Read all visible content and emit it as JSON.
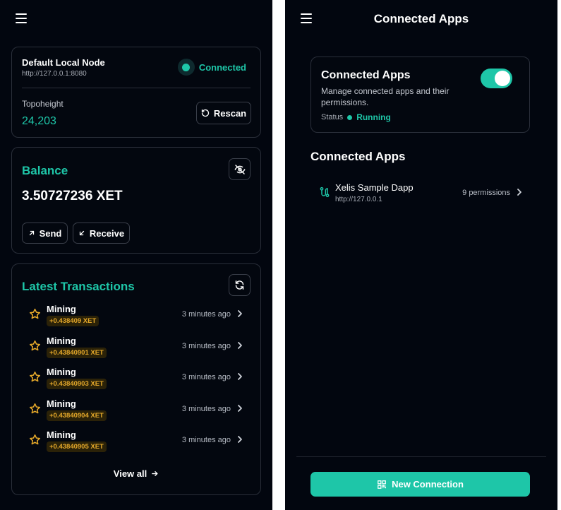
{
  "left": {
    "node": {
      "name": "Default Local Node",
      "url": "http://127.0.0.1:8080",
      "status": "Connected",
      "topoheight_label": "Topoheight",
      "topoheight_value": "24,203",
      "rescan_label": "Rescan"
    },
    "balance": {
      "title": "Balance",
      "amount": "3.50727236 XET",
      "send_label": "Send",
      "receive_label": "Receive"
    },
    "transactions": {
      "title": "Latest Transactions",
      "items": [
        {
          "type": "Mining",
          "amount": "+0.438409 XET",
          "time": "3 minutes ago"
        },
        {
          "type": "Mining",
          "amount": "+0.43840901 XET",
          "time": "3 minutes ago"
        },
        {
          "type": "Mining",
          "amount": "+0.43840903 XET",
          "time": "3 minutes ago"
        },
        {
          "type": "Mining",
          "amount": "+0.43840904 XET",
          "time": "3 minutes ago"
        },
        {
          "type": "Mining",
          "amount": "+0.43840905 XET",
          "time": "3 minutes ago"
        }
      ],
      "view_all_label": "View all"
    }
  },
  "right": {
    "title": "Connected Apps",
    "service": {
      "title": "Connected Apps",
      "description": "Manage connected apps and their permissions.",
      "status_label": "Status",
      "status_value": "Running",
      "enabled": true
    },
    "section_title": "Connected Apps",
    "apps": [
      {
        "name": "Xelis Sample Dapp",
        "url": "http://127.0.0.1",
        "permissions": "9 permissions"
      }
    ],
    "new_connection_label": "New Connection"
  },
  "colors": {
    "accent": "#1ec6a8",
    "background": "#02060f",
    "amount": "#e6a92a"
  },
  "icons": [
    "menu-icon",
    "refresh-icon",
    "eye-off-icon",
    "arrow-up-right-icon",
    "arrow-down-left-icon",
    "star-icon",
    "chevron-right-icon",
    "arrow-right-icon",
    "route-icon",
    "qr-code-icon"
  ]
}
